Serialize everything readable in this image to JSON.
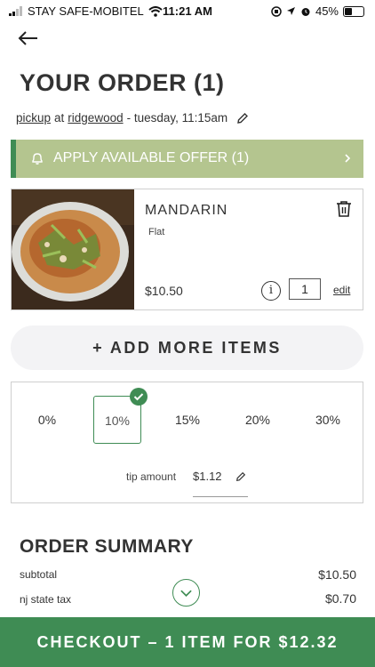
{
  "status_bar": {
    "carrier": "STAY SAFE-MOBITEL",
    "time": "11:21 AM",
    "battery": "45%",
    "battery_level": 0.45
  },
  "header": {
    "title": "YOUR ORDER (1)"
  },
  "order_meta": {
    "mode": "pickup",
    "at": "at",
    "location": "ridgewood",
    "schedule": "- tuesday, 11:15am"
  },
  "offer": {
    "label": "APPLY AVAILABLE OFFER (1)"
  },
  "item": {
    "name": "MANDARIN",
    "variant": "Flat",
    "price": "$10.50",
    "quantity": "1",
    "edit_label": "edit",
    "info_glyph": "i"
  },
  "add_more": {
    "label": "+ ADD MORE ITEMS"
  },
  "tips": {
    "options": [
      "0%",
      "10%",
      "15%",
      "20%",
      "30%"
    ],
    "selected": "10%",
    "amount_label": "tip amount",
    "amount_value": "$1.12"
  },
  "summary": {
    "title": "ORDER SUMMARY",
    "rows": [
      {
        "label": "subtotal",
        "value": "$10.50"
      },
      {
        "label": "nj state tax",
        "value": "$0.70"
      }
    ]
  },
  "checkout": {
    "label": "CHECKOUT – 1 ITEM FOR $12.32"
  },
  "colors": {
    "accent_green": "#3f8c54",
    "offer_bg": "#b4c58f",
    "add_more_bg": "#f3f3f5"
  }
}
